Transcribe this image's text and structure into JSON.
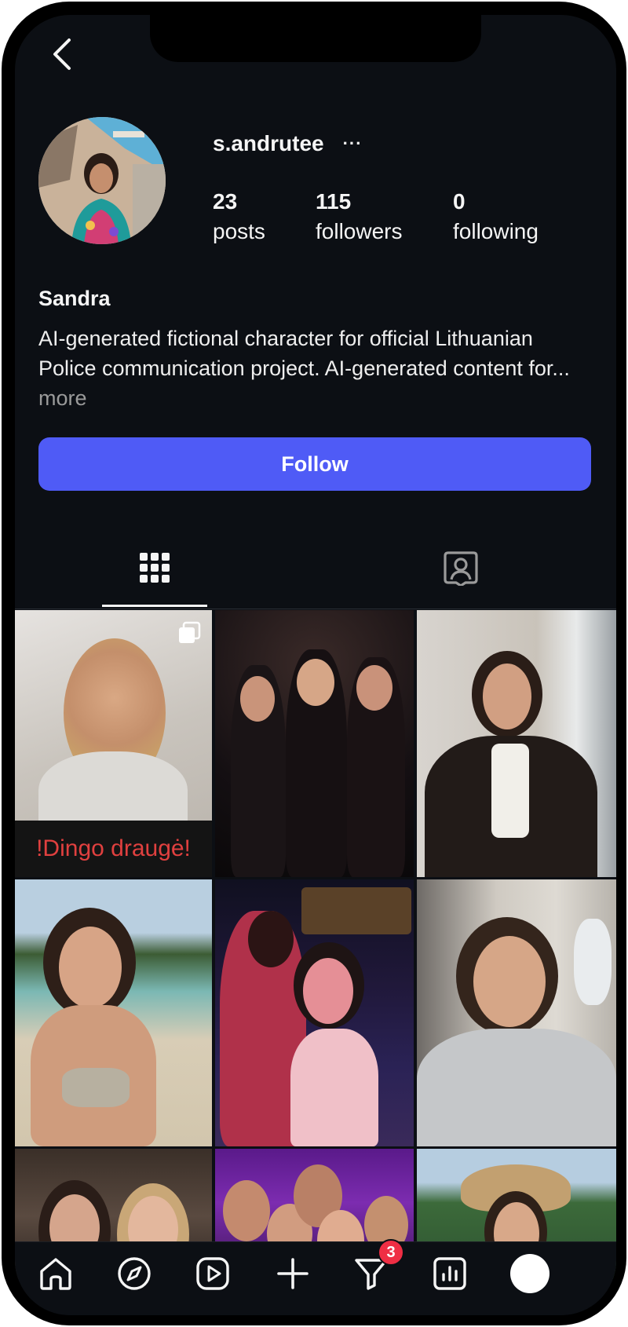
{
  "profile": {
    "username": "s.andrutee",
    "more_menu": "···",
    "display_name": "Sandra",
    "bio_text": "AI-generated fictional character for official Lithuanian Police communication project. AI-generated content for...",
    "bio_more": "more"
  },
  "stats": [
    {
      "value": "23",
      "label": "posts"
    },
    {
      "value": "115",
      "label": "followers"
    },
    {
      "value": "0",
      "label": "following"
    }
  ],
  "actions": {
    "follow_label": "Follow"
  },
  "tabs": [
    {
      "icon": "grid-icon",
      "active": true
    },
    {
      "icon": "tagged-icon",
      "active": false
    }
  ],
  "posts": [
    {
      "caption": "!Dingo draugė!",
      "multi": true
    },
    {
      "caption": "",
      "multi": false
    },
    {
      "caption": "",
      "multi": false
    },
    {
      "caption": "",
      "multi": false
    },
    {
      "caption": "",
      "multi": false
    },
    {
      "caption": "",
      "multi": false
    },
    {
      "caption": "",
      "multi": false
    },
    {
      "caption": "",
      "multi": false
    },
    {
      "caption": "",
      "multi": false
    }
  ],
  "bottom_nav": {
    "items": [
      "home-icon",
      "explore-icon",
      "reels-icon",
      "create-icon",
      "activity-icon",
      "insights-icon",
      "profile-icon"
    ],
    "activity_badge": "3"
  },
  "colors": {
    "background": "#0c0f14",
    "follow_button": "#4f5bf6",
    "badge": "#ef2e44",
    "caption_text": "#e0403f"
  }
}
